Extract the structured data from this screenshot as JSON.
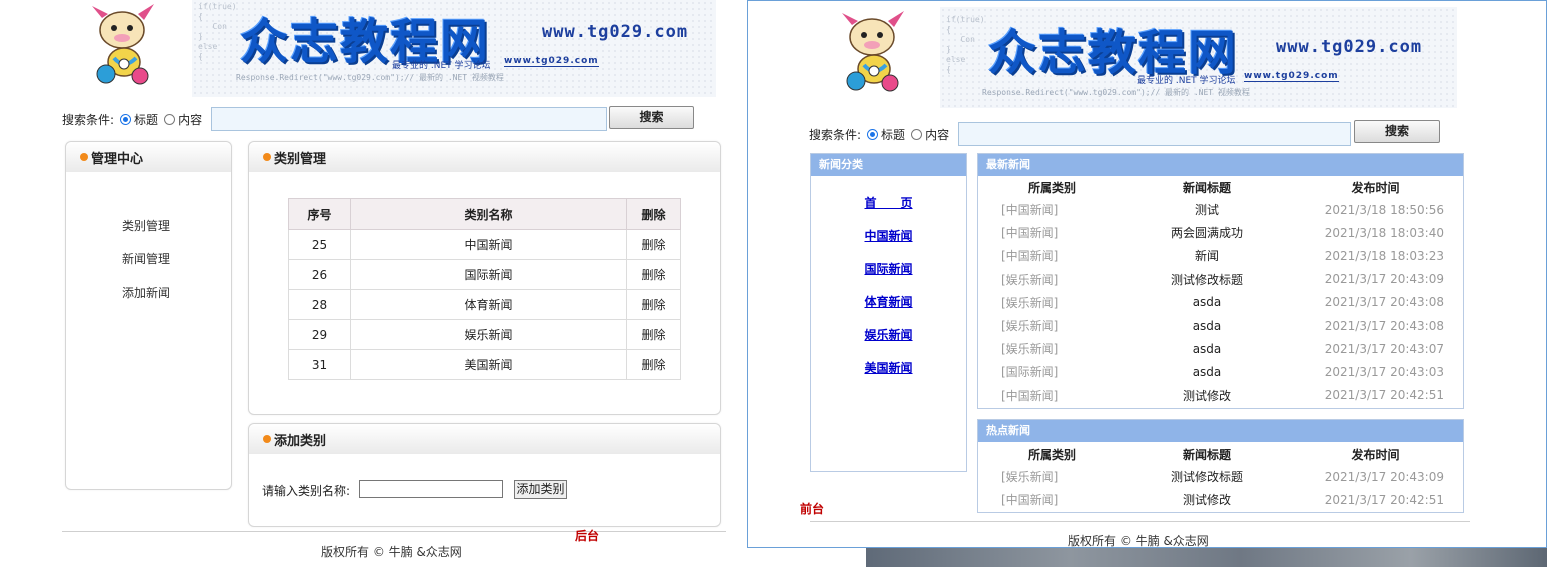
{
  "brand": {
    "name": "众志教程网",
    "url": "www.tg029.com",
    "slogan": "最专业的 .NET 学习论坛",
    "small_url": "www.tg029.com",
    "code_snippet": "if(true)\n{\n   Con\n}\nelse\n{",
    "redirect_text": "Response.Redirect(\"www.tg029.com\");// 最新的 .NET 视频教程"
  },
  "search": {
    "label": "搜索条件:",
    "options": [
      "标题",
      "内容"
    ],
    "selected": "标题",
    "value": "",
    "button": "搜索"
  },
  "backend": {
    "tag": "后台",
    "sidebar": {
      "title": "管理中心",
      "items": [
        "类别管理",
        "新闻管理",
        "添加新闻"
      ]
    },
    "category_panel": {
      "title": "类别管理",
      "columns": [
        "序号",
        "类别名称",
        "删除"
      ],
      "rows": [
        {
          "id": "25",
          "name": "中国新闻",
          "action": "删除"
        },
        {
          "id": "26",
          "name": "国际新闻",
          "action": "删除"
        },
        {
          "id": "28",
          "name": "体育新闻",
          "action": "删除"
        },
        {
          "id": "29",
          "name": "娱乐新闻",
          "action": "删除"
        },
        {
          "id": "31",
          "name": "美国新闻",
          "action": "删除"
        }
      ]
    },
    "add_panel": {
      "title": "添加类别",
      "label": "请输入类别名称:",
      "value": "",
      "button": "添加类别"
    },
    "footer": "版权所有 © 牛腩 &众志网"
  },
  "frontend": {
    "tag": "前台",
    "category_box": {
      "title": "新闻分类",
      "links": [
        "首　　页",
        "中国新闻",
        "国际新闻",
        "体育新闻",
        "娱乐新闻",
        "美国新闻"
      ]
    },
    "latest": {
      "title": "最新新闻",
      "columns": [
        "所属类别",
        "新闻标题",
        "发布时间"
      ],
      "rows": [
        {
          "cat": "[中国新闻]",
          "title": "测试",
          "time": "2021/3/18 18:50:56"
        },
        {
          "cat": "[中国新闻]",
          "title": "两会圆满成功",
          "time": "2021/3/18 18:03:40"
        },
        {
          "cat": "[中国新闻]",
          "title": "新闻",
          "time": "2021/3/18 18:03:23"
        },
        {
          "cat": "[娱乐新闻]",
          "title": "测试修改标题",
          "time": "2021/3/17 20:43:09"
        },
        {
          "cat": "[娱乐新闻]",
          "title": "asda",
          "time": "2021/3/17 20:43:08"
        },
        {
          "cat": "[娱乐新闻]",
          "title": "asda",
          "time": "2021/3/17 20:43:08"
        },
        {
          "cat": "[娱乐新闻]",
          "title": "asda",
          "time": "2021/3/17 20:43:07"
        },
        {
          "cat": "[国际新闻]",
          "title": "asda",
          "time": "2021/3/17 20:43:03"
        },
        {
          "cat": "[中国新闻]",
          "title": "测试修改",
          "time": "2021/3/17 20:42:51"
        }
      ]
    },
    "hot": {
      "title": "热点新闻",
      "columns": [
        "所属类别",
        "新闻标题",
        "发布时间"
      ],
      "rows": [
        {
          "cat": "[娱乐新闻]",
          "title": "测试修改标题",
          "time": "2021/3/17 20:43:09"
        },
        {
          "cat": "[中国新闻]",
          "title": "测试修改",
          "time": "2021/3/17 20:42:51"
        }
      ]
    },
    "footer": "版权所有 © 牛腩 &众志网"
  },
  "colors": {
    "brand_blue": "#0f57c7",
    "accent_orange": "#f28a1a",
    "header_blue": "#8fb4e8",
    "tag_red": "#c00000"
  }
}
